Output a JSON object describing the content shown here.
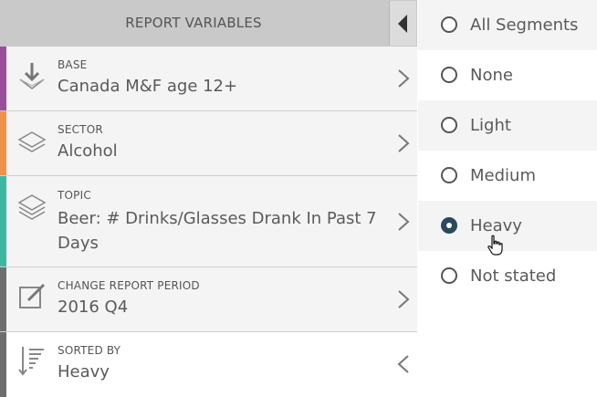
{
  "panel": {
    "title": "REPORT VARIABLES"
  },
  "colors": {
    "base": "#9a4d99",
    "sector": "#f0914a",
    "topic": "#3db8a0",
    "period": "#6e6e6e",
    "sorted": "#6e6e6e",
    "selected_radio": "#2b4a5c"
  },
  "rows": [
    {
      "label": "BASE",
      "value": "Canada M&F age 12+",
      "icon": "download-tray-icon"
    },
    {
      "label": "SECTOR",
      "value": "Alcohol",
      "icon": "layers-icon"
    },
    {
      "label": "TOPIC",
      "value": "Beer: # Drinks/Glasses Drank In Past 7 Days",
      "icon": "stacked-layers-icon"
    },
    {
      "label": "CHANGE REPORT PERIOD",
      "value": "2016 Q4",
      "icon": "edit-icon"
    },
    {
      "label": "SORTED BY",
      "value": "Heavy",
      "icon": "sort-descending-icon"
    }
  ],
  "options": [
    {
      "label": "All Segments",
      "checked": false
    },
    {
      "label": "None",
      "checked": false
    },
    {
      "label": "Light",
      "checked": false
    },
    {
      "label": "Medium",
      "checked": false
    },
    {
      "label": "Heavy",
      "checked": true
    },
    {
      "label": "Not stated",
      "checked": false
    }
  ]
}
